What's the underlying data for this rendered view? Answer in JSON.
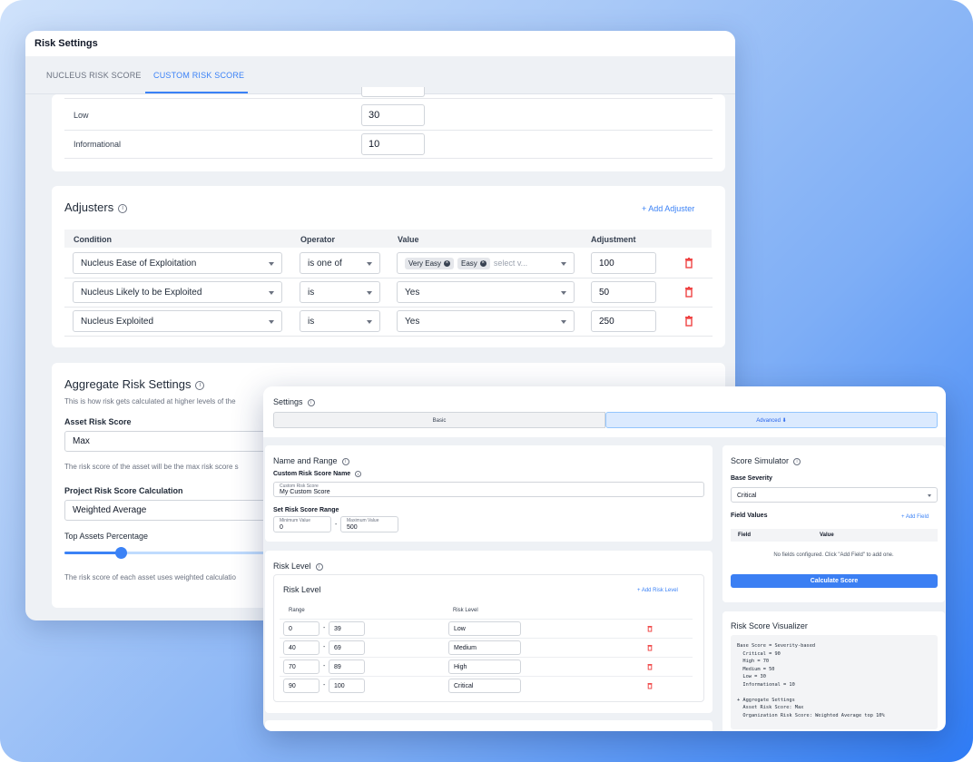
{
  "back_window": {
    "title": "Risk Settings",
    "tabs": [
      {
        "label": "NUCLEUS RISK SCORE",
        "active": false
      },
      {
        "label": "CUSTOM RISK SCORE",
        "active": true
      }
    ],
    "severity_scores": [
      {
        "label": "Low",
        "value": "30"
      },
      {
        "label": "Informational",
        "value": "10"
      }
    ],
    "adjusters": {
      "title": "Adjusters",
      "add_label": "+ Add Adjuster",
      "columns": [
        "Condition",
        "Operator",
        "Value",
        "Adjustment"
      ],
      "rows": [
        {
          "condition": "Nucleus Ease of Exploitation",
          "operator": "is one of",
          "chips": [
            "Very Easy",
            "Easy"
          ],
          "value_placeholder": "select v...",
          "adjustment": "100"
        },
        {
          "condition": "Nucleus Likely to be Exploited",
          "operator": "is",
          "value": "Yes",
          "adjustment": "50"
        },
        {
          "condition": "Nucleus Exploited",
          "operator": "is",
          "value": "Yes",
          "adjustment": "250"
        }
      ]
    },
    "aggregate": {
      "title": "Aggregate Risk Settings",
      "description": "This is how risk gets calculated at higher levels of the",
      "asset_label": "Asset Risk Score",
      "asset_value": "Max",
      "asset_help": "The risk score of the asset will be the max risk score s",
      "project_label": "Project Risk Score Calculation",
      "project_value": "Weighted Average",
      "top_assets_label": "Top Assets Percentage",
      "top_assets_percent": 24,
      "bottom_help": "The risk score of each asset uses weighted calculatio"
    }
  },
  "front_window": {
    "settings_title": "Settings",
    "modes": [
      {
        "label": "Basic",
        "active": false
      },
      {
        "label": "Advanced ⬇",
        "active": true
      }
    ],
    "name_range": {
      "title": "Name and Range",
      "custom_name_label": "Custom Risk Score Name",
      "custom_name_small": "Custom Risk Score",
      "custom_name_value": "My Custom Score",
      "range_label": "Set Risk Score Range",
      "min_label": "Minimum Value",
      "min_value": "0",
      "max_label": "Maximum Value",
      "max_value": "500"
    },
    "risk_level": {
      "title": "Risk Level",
      "inner_title": "Risk Level",
      "add_label": "+ Add Risk Level",
      "columns": [
        "Range",
        "Risk Level"
      ],
      "rows": [
        {
          "min": "0",
          "max": "39",
          "level": "Low"
        },
        {
          "min": "40",
          "max": "69",
          "level": "Medium"
        },
        {
          "min": "70",
          "max": "89",
          "level": "High"
        },
        {
          "min": "90",
          "max": "100",
          "level": "Critical"
        }
      ]
    },
    "simulator": {
      "title": "Score Simulator",
      "base_label": "Base Severity",
      "base_value": "Critical",
      "field_values_label": "Field Values",
      "add_field": "+ Add Field",
      "columns": [
        "Field",
        "Value"
      ],
      "empty_text": "No fields configured. Click \"Add Field\" to add one.",
      "calc_button": "Calculate Score"
    },
    "visualizer": {
      "title": "Risk Score Visualizer",
      "lines": [
        "Base Score = Severity-based",
        "  Critical = 90",
        "  High = 70",
        "  Medium = 50",
        "  Low = 30",
        "  Informational = 10",
        "",
        "+ Aggregate Settings",
        "  Asset Risk Score: Max",
        "  Organization Risk Score: Weighted Average top 10%"
      ]
    }
  },
  "colors": {
    "accent": "#3b82f6",
    "danger": "#ef4444",
    "button": "#3b7ff3"
  }
}
